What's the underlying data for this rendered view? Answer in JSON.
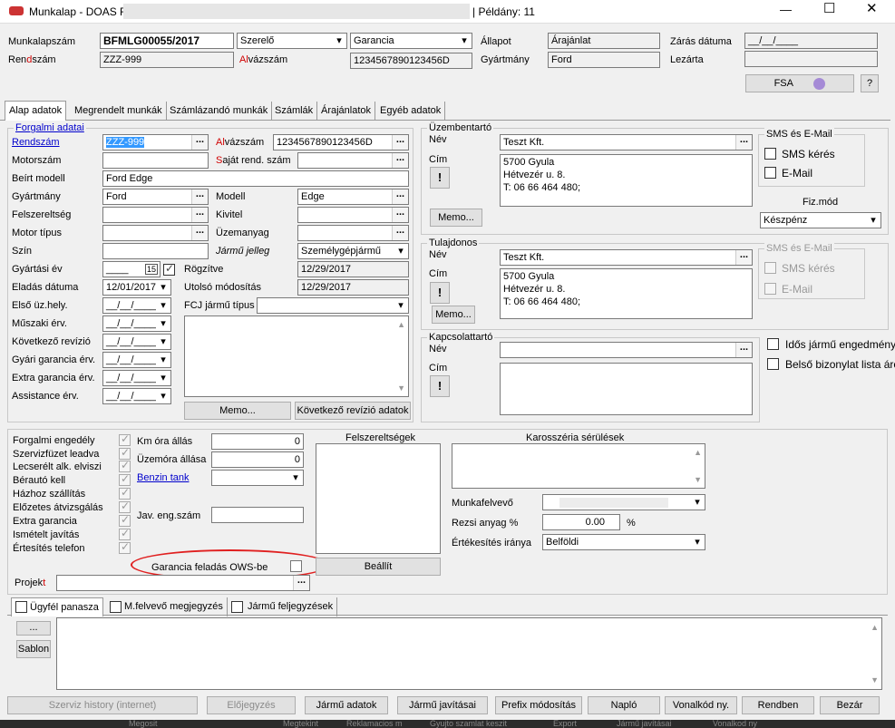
{
  "window": {
    "title": "Munkalap - DOAS F",
    "copies": "| Példány: 11",
    "min": "—",
    "max": "☐",
    "close": "✕"
  },
  "header": {
    "munkalapszam_label": "Munkalapszám",
    "munkalapszam": "BFMLG00055/2017",
    "szerelo": "Szerelő",
    "garancia": "Garancia",
    "allapot_label": "Állapot",
    "allapot": "Árajánlat",
    "zaras_label": "Zárás dátuma",
    "zaras": "__/__/____",
    "rendszam_label_a": "Ren",
    "rendszam_label_b": "d",
    "rendszam_label_c": "szám",
    "rendszam": "ZZZ-999",
    "alvazszam_label_a": "Al",
    "alvazszam_label_b": "vázszám",
    "alvazszam": "1234567890123456D",
    "gyartmany_label": "Gyártmány",
    "gyartmany": "Ford",
    "lezarta_label": "Lezárta",
    "lezarta": "",
    "fsa": "FSA",
    "help": "?"
  },
  "tabs": [
    "Alap adatok",
    "Megrendelt munkák",
    "Számlázandó munkák",
    "Számlák",
    "Árajánlatok",
    "Egyéb adatok"
  ],
  "vehicle": {
    "forgalmi": "Forgalmi adatai",
    "rendszam_label": "Rendszám",
    "rendszam": "ZZZ-999",
    "alvazszam_label_a": "Al",
    "alvazszam_label_b": "vázszám",
    "alvazszam": "1234567890123456D",
    "motorszam_label": "Motorszám",
    "sajat_label_a": "S",
    "sajat_label_b": "aját rend. szám",
    "beirt_label": "Beírt modell",
    "beirt": "Ford Edge",
    "gyartmany_label": "Gyártmány",
    "gyartmany": "Ford",
    "modell_label": "Modell",
    "modell": "Edge",
    "felszereltseg_label": "Felszereltség",
    "kivitel_label": "Kivitel",
    "motortipus_label": "Motor típus",
    "uzemanyag_label": "Üzemanyag",
    "szin_label": "Szín",
    "jarmu_jelleg_label": "Jármű jelleg",
    "jarmu_jelleg": "Személygépjármű",
    "gyartasi_label": "Gyártási év",
    "gyartasi": "____",
    "gyartasi_spin": "15",
    "rogzitve_label": "Rögzítve",
    "rogzitve": "12/29/2017",
    "eladas_label": "Eladás dátuma",
    "eladas": "12/01/2017",
    "utolso_label": "Utolsó módosítás",
    "utolso": "12/29/2017",
    "elso_label": "Első üz.hely.",
    "fcj_label": "FCJ jármű típus",
    "muszaki_label": "Műszaki érv.",
    "kovetkezo_label": "Következő revízió",
    "gyari_label": "Gyári garancia érv.",
    "extra_label": "Extra garancia érv.",
    "assistance_label": "Assistance érv.",
    "empty_date": "__/__/____",
    "memo": "Memo...",
    "kovetkezo_btn": "Következő revízió adatok"
  },
  "uzembentarto": {
    "title": "Üzembentartó",
    "nev_label": "Név",
    "nev": "Teszt Kft.",
    "cim_label": "Cím",
    "cim": [
      "5700 Gyula",
      "Hétvezér u. 8.",
      "T: 06 66 464 480;"
    ],
    "memo": "Memo...",
    "sms_group": "SMS és E-Mail",
    "sms": "SMS kérés",
    "email": "E-Mail",
    "fizmod_label": "Fiz.mód",
    "fizmod": "Készpénz"
  },
  "tulajdonos": {
    "title": "Tulajdonos",
    "nev_label": "Név",
    "nev": "Teszt Kft.",
    "cim_label": "Cím",
    "cim": [
      "5700 Gyula",
      "Hétvezér u. 8.",
      "T: 06 66 464 480;"
    ],
    "memo": "Memo...",
    "sms_group": "SMS és E-Mail",
    "sms": "SMS kérés",
    "email": "E-Mail"
  },
  "kapcsolattarto": {
    "title": "Kapcsolattartó",
    "nev_label": "Név",
    "cim_label": "Cím"
  },
  "right_checks": {
    "idos": "Idős jármű engedmény",
    "belso": "Belső bizonylat lista áron"
  },
  "checks": [
    "Forgalmi engedély",
    "Szervizfüzet leadva",
    "Lecserélt alk. elviszi",
    "Bérautó kell",
    "Házhoz szállítás",
    "Előzetes átvizsgálás",
    "Extra garancia",
    "Ismételt javítás",
    "Értesítés telefon"
  ],
  "km_label": "Km óra állás",
  "km": "0",
  "uzemora_label": "Üzemóra állása",
  "uzemora": "0",
  "benzin_label": "Benzin tank",
  "javeng_label": "Jav. eng.szám",
  "felszereltsegek": "Felszereltségek",
  "karosszeria": "Karosszéria sérülések",
  "munkafelvevo_label": "Munkafelvevő",
  "rezsi_label": "Rezsi anyag %",
  "rezsi": "0.00",
  "rezsi_unit": "%",
  "ertek_label": "Értékesítés iránya",
  "ertek": "Belföldi",
  "garancia_ows": "Garancia feladás OWS-be",
  "beallit": "Beállít",
  "projekt_label_a": "Projek",
  "projekt_label_b": "t",
  "subtabs": [
    "Ügyfél panasza",
    "M.felvevő megjegyzés",
    "Jármű feljegyzések"
  ],
  "small_dots": "...",
  "sablon": "Sablon",
  "bottom_buttons": [
    "Szerviz history (internet)",
    "Előjegyzés",
    "Jármű adatok",
    "Jármű javításai",
    "Prefix módosítás",
    "Napló",
    "Vonalkód ny.",
    "Rendben",
    "Bezár"
  ],
  "taskbar": [
    "Megosit",
    "Megtekint",
    "Reklamacios m",
    "Gyujto szamlat keszit",
    "Export",
    "Jármű javításai",
    "Vonalkod ny"
  ],
  "colors": {
    "highlight": "#3399ff",
    "link": "#0000cc",
    "required": "#d00000",
    "annotation": "#e02020"
  }
}
